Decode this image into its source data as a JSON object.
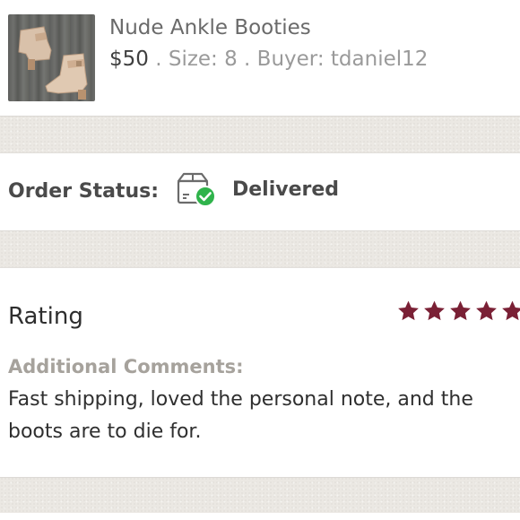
{
  "item": {
    "title": "Nude Ankle Booties",
    "price": "$50",
    "details": " . Size: 8 . Buyer: tdaniel12",
    "thumbnail_icon": "boot-photo"
  },
  "order": {
    "status_label": "Order Status:",
    "status_value": "Delivered",
    "status_icon": "delivered-box-check-icon",
    "status_color": "#2fb34b"
  },
  "rating": {
    "title": "Rating",
    "stars": 5,
    "star_color": "#7a2035",
    "comments_label": "Additional Comments:",
    "comments_text": "Fast shipping, loved the personal note, and the boots are to die for."
  }
}
